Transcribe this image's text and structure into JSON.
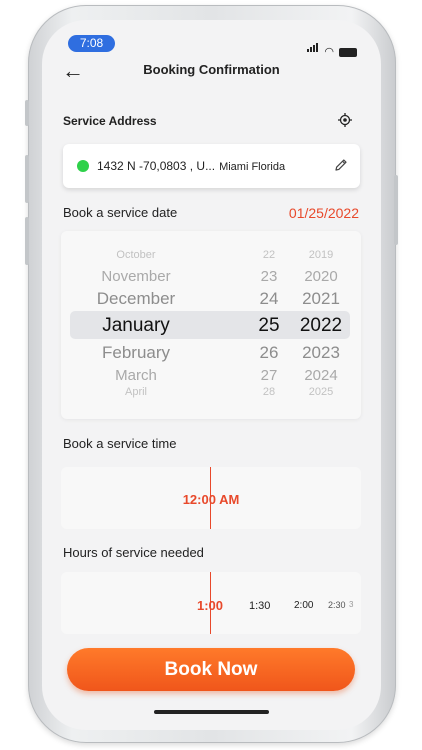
{
  "status": {
    "time": "7:08"
  },
  "header": {
    "title": "Booking Confirmation"
  },
  "address": {
    "label": "Service Address",
    "street": "1432 N  -70,0803  , U...",
    "city": "Miami Florida"
  },
  "date": {
    "label": "Book a service date",
    "value": "01/25/2022",
    "months": [
      "October",
      "November",
      "December",
      "January",
      "February",
      "March",
      "April"
    ],
    "days": [
      "22",
      "23",
      "24",
      "25",
      "26",
      "27",
      "28"
    ],
    "years": [
      "2019",
      "2020",
      "2021",
      "2022",
      "2023",
      "2024",
      "2025"
    ]
  },
  "time": {
    "label": "Book a service time",
    "value": "12:00 AM"
  },
  "hours": {
    "label": "Hours  of service needed",
    "options": [
      "1:00",
      "1:30",
      "2:00",
      "2:30",
      "3"
    ]
  },
  "cta": {
    "label": "Book Now"
  },
  "colors": {
    "accent": "#e8492b",
    "button": "#f0561b",
    "status_dot": "#2ed14a",
    "time_pill": "#2f6ee0"
  },
  "icons": [
    "back-arrow-icon",
    "location-target-icon",
    "pencil-icon",
    "signal-icon",
    "wifi-icon",
    "battery-icon"
  ]
}
